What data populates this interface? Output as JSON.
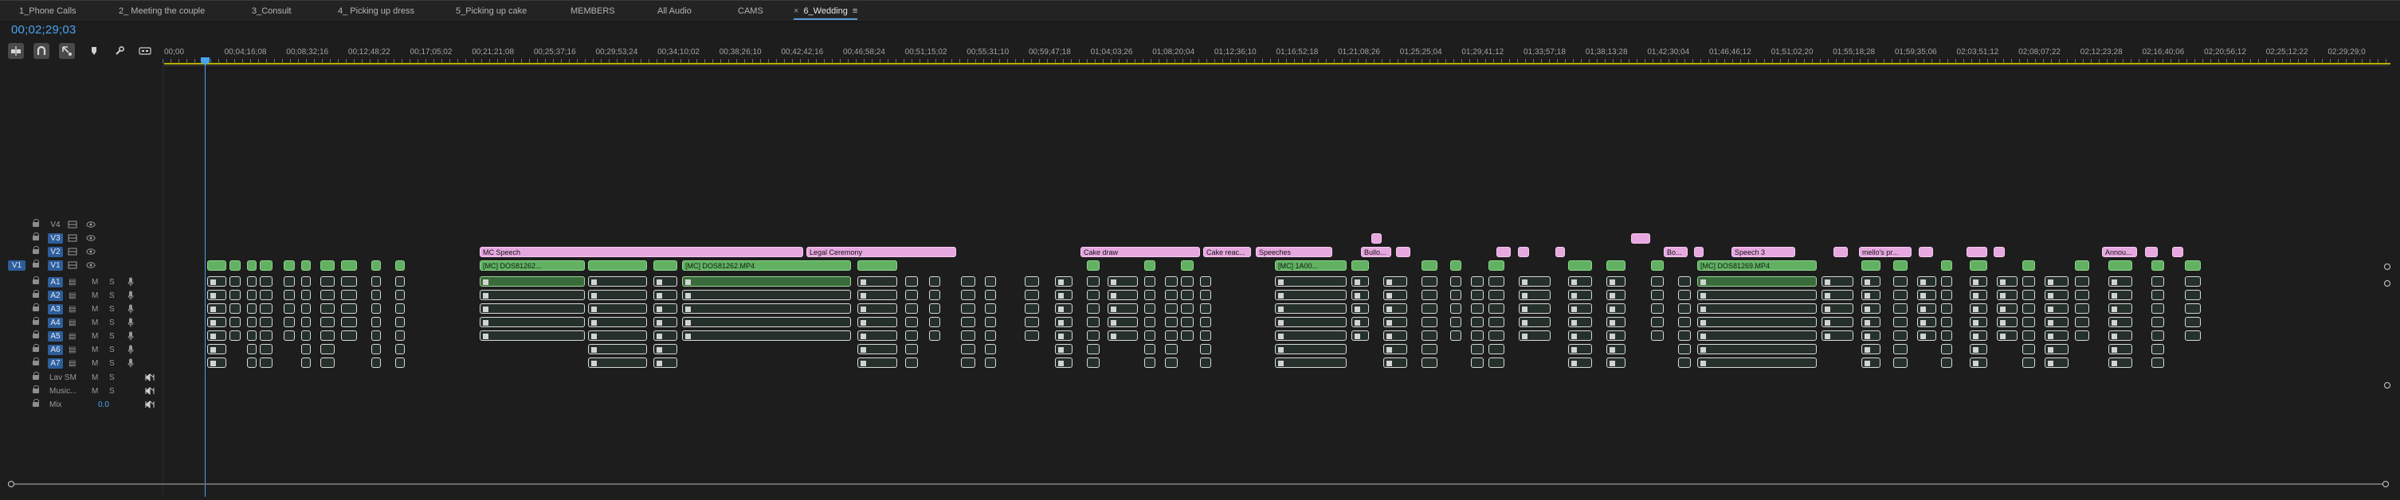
{
  "tabs": [
    {
      "label": "1_Phone Calls"
    },
    {
      "label": "2_ Meeting the couple"
    },
    {
      "label": "3_Consult"
    },
    {
      "label": "4_ Picking up dress"
    },
    {
      "label": "5_Picking up cake"
    },
    {
      "label": "MEMBERS"
    },
    {
      "label": "All Audio"
    },
    {
      "label": "CAMS"
    },
    {
      "label": "6_Wedding",
      "active": true
    }
  ],
  "tab_close_glyph": "×",
  "tab_menu_glyph": "≡",
  "timecode": "00;02;29;03",
  "tools": [
    {
      "name": "insert-overwrite-icon"
    },
    {
      "name": "snap-icon"
    },
    {
      "name": "linked-selection-icon"
    },
    {
      "name": "add-marker-icon"
    },
    {
      "name": "wrench-icon"
    },
    {
      "name": "captions-icon"
    }
  ],
  "ruler_ticks": [
    "00;00",
    "00;04;16;08",
    "00;08;32;16",
    "00;12;48;22",
    "00;17;05;02",
    "00;21;21;08",
    "00;25;37;16",
    "00;29;53;24",
    "00;34;10;02",
    "00;38;26;10",
    "00;42;42;16",
    "00;46;58;24",
    "00;51;15;02",
    "00;55;31;10",
    "00;59;47;18",
    "01;04;03;26",
    "01;08;20;04",
    "01;12;36;10",
    "01;16;52;18",
    "01;21;08;26",
    "01;25;25;04",
    "01;29;41;12",
    "01;33;57;18",
    "01;38;13;28",
    "01;42;30;04",
    "01;46;46;12",
    "01;51;02;20",
    "01;55;18;28",
    "01;59;35;06",
    "02;03;51;12",
    "02;08;07;22",
    "02;12;23;28",
    "02;16;40;06",
    "02;20;56;12",
    "02;25;12;22",
    "02;29;29;0"
  ],
  "tracks": {
    "video": [
      {
        "label": "V4"
      },
      {
        "label": "V3"
      },
      {
        "label": "V2"
      },
      {
        "label": "V1",
        "source": "V1"
      }
    ],
    "audio": [
      {
        "label": "A1"
      },
      {
        "label": "A2"
      },
      {
        "label": "A3"
      },
      {
        "label": "A4"
      },
      {
        "label": "A5"
      },
      {
        "label": "A6"
      },
      {
        "label": "A7"
      }
    ],
    "submix": [
      {
        "label": "Lav SM"
      },
      {
        "label": "Music..."
      }
    ],
    "mix": {
      "label": "Mix",
      "value": "0.0"
    },
    "mute_glyph": "M",
    "solo_glyph": "S"
  },
  "clips_v2": [
    {
      "label": "MC Speech"
    },
    {
      "label": "Legal Ceremony"
    },
    {
      "label": "Cake draw"
    },
    {
      "label": "Cake reac..."
    },
    {
      "label": "Speeches"
    },
    {
      "label": "Bullo..."
    },
    {
      "label": "Bo..."
    },
    {
      "label": "Speech 3"
    },
    {
      "label": "mello's pr..."
    },
    {
      "label": "Annou..."
    }
  ],
  "clips_v1": [
    {
      "label": "[MC] DOS81262..."
    },
    {
      "label": "[MC] DOS81262.MP4"
    },
    {
      "label": "[MC] 1A00..."
    },
    {
      "label": "[MC] DOS81269.MP4"
    }
  ],
  "colors": {
    "accent": "#4ba3f0",
    "pink_clip": "#e7a8e0",
    "green_clip": "#62b062",
    "work_area": "#b7b000",
    "target_track": "#2d5e9b"
  }
}
